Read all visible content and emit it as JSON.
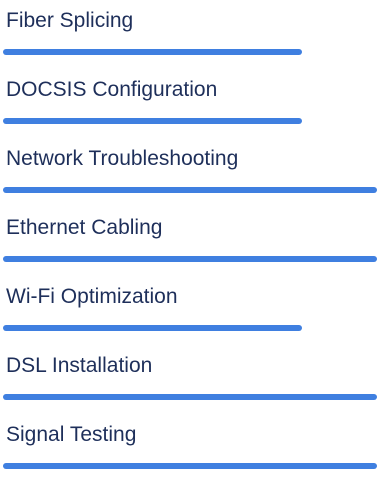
{
  "skills": {
    "items": [
      {
        "label": "Fiber Splicing",
        "level": 0.8
      },
      {
        "label": "DOCSIS Configuration",
        "level": 0.8
      },
      {
        "label": "Network Troubleshooting",
        "level": 1.0
      },
      {
        "label": "Ethernet Cabling",
        "level": 1.0
      },
      {
        "label": "Wi-Fi Optimization",
        "level": 0.8
      },
      {
        "label": "DSL Installation",
        "level": 1.0
      },
      {
        "label": "Signal Testing",
        "level": 1.0
      }
    ]
  },
  "colors": {
    "bar": "#3f7fe0",
    "label": "#1e2f5a"
  }
}
